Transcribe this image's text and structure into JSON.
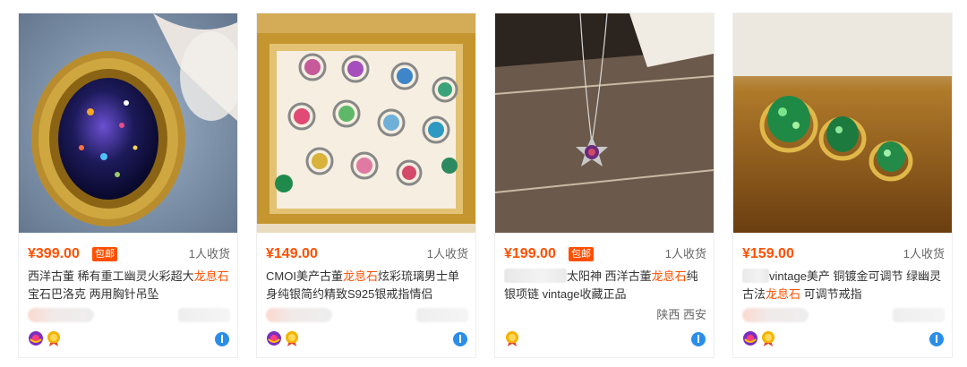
{
  "products": [
    {
      "price": "¥399.00",
      "badge": "包邮",
      "sales": "1人收货",
      "title_before": "西洋古董 稀有重工幽灵火彩超大",
      "title_highlight": "龙息石",
      "title_after": "宝石巴洛克 两用胸针吊坠",
      "location": "",
      "icons": [
        "tmall-icon",
        "gold-seller-icon",
        "wangwang-icon"
      ]
    },
    {
      "price": "¥149.00",
      "badge": "",
      "sales": "1人收货",
      "title_before": "CMOI美产古董",
      "title_highlight": "龙息石",
      "title_after": "炫彩琉璃男士单身纯银简约精致S925银戒指情侣",
      "location": "",
      "icons": [
        "tmall-icon",
        "gold-seller-icon",
        "wangwang-icon"
      ]
    },
    {
      "price": "¥199.00",
      "badge": "包邮",
      "sales": "1人收货",
      "title_before": "太阳神 西洋古董",
      "title_highlight": "龙息石",
      "title_after": "纯银项链 vintage收藏正品",
      "location": "陕西 西安",
      "icons": [
        "gold-seller-icon",
        "wangwang-icon"
      ]
    },
    {
      "price": "¥159.00",
      "badge": "",
      "sales": "1人收货",
      "title_before": "vintage美产 铜镀金可调节 绿幽灵古法",
      "title_highlight": "龙息石",
      "title_after": " 可调节戒指",
      "location": "",
      "icons": [
        "tmall-icon",
        "gold-seller-icon",
        "wangwang-icon"
      ]
    }
  ],
  "colors": {
    "price": "#ff5000",
    "badge_bg": "#ff5000",
    "highlight": "#ff5000",
    "border": "#eeeeee"
  }
}
